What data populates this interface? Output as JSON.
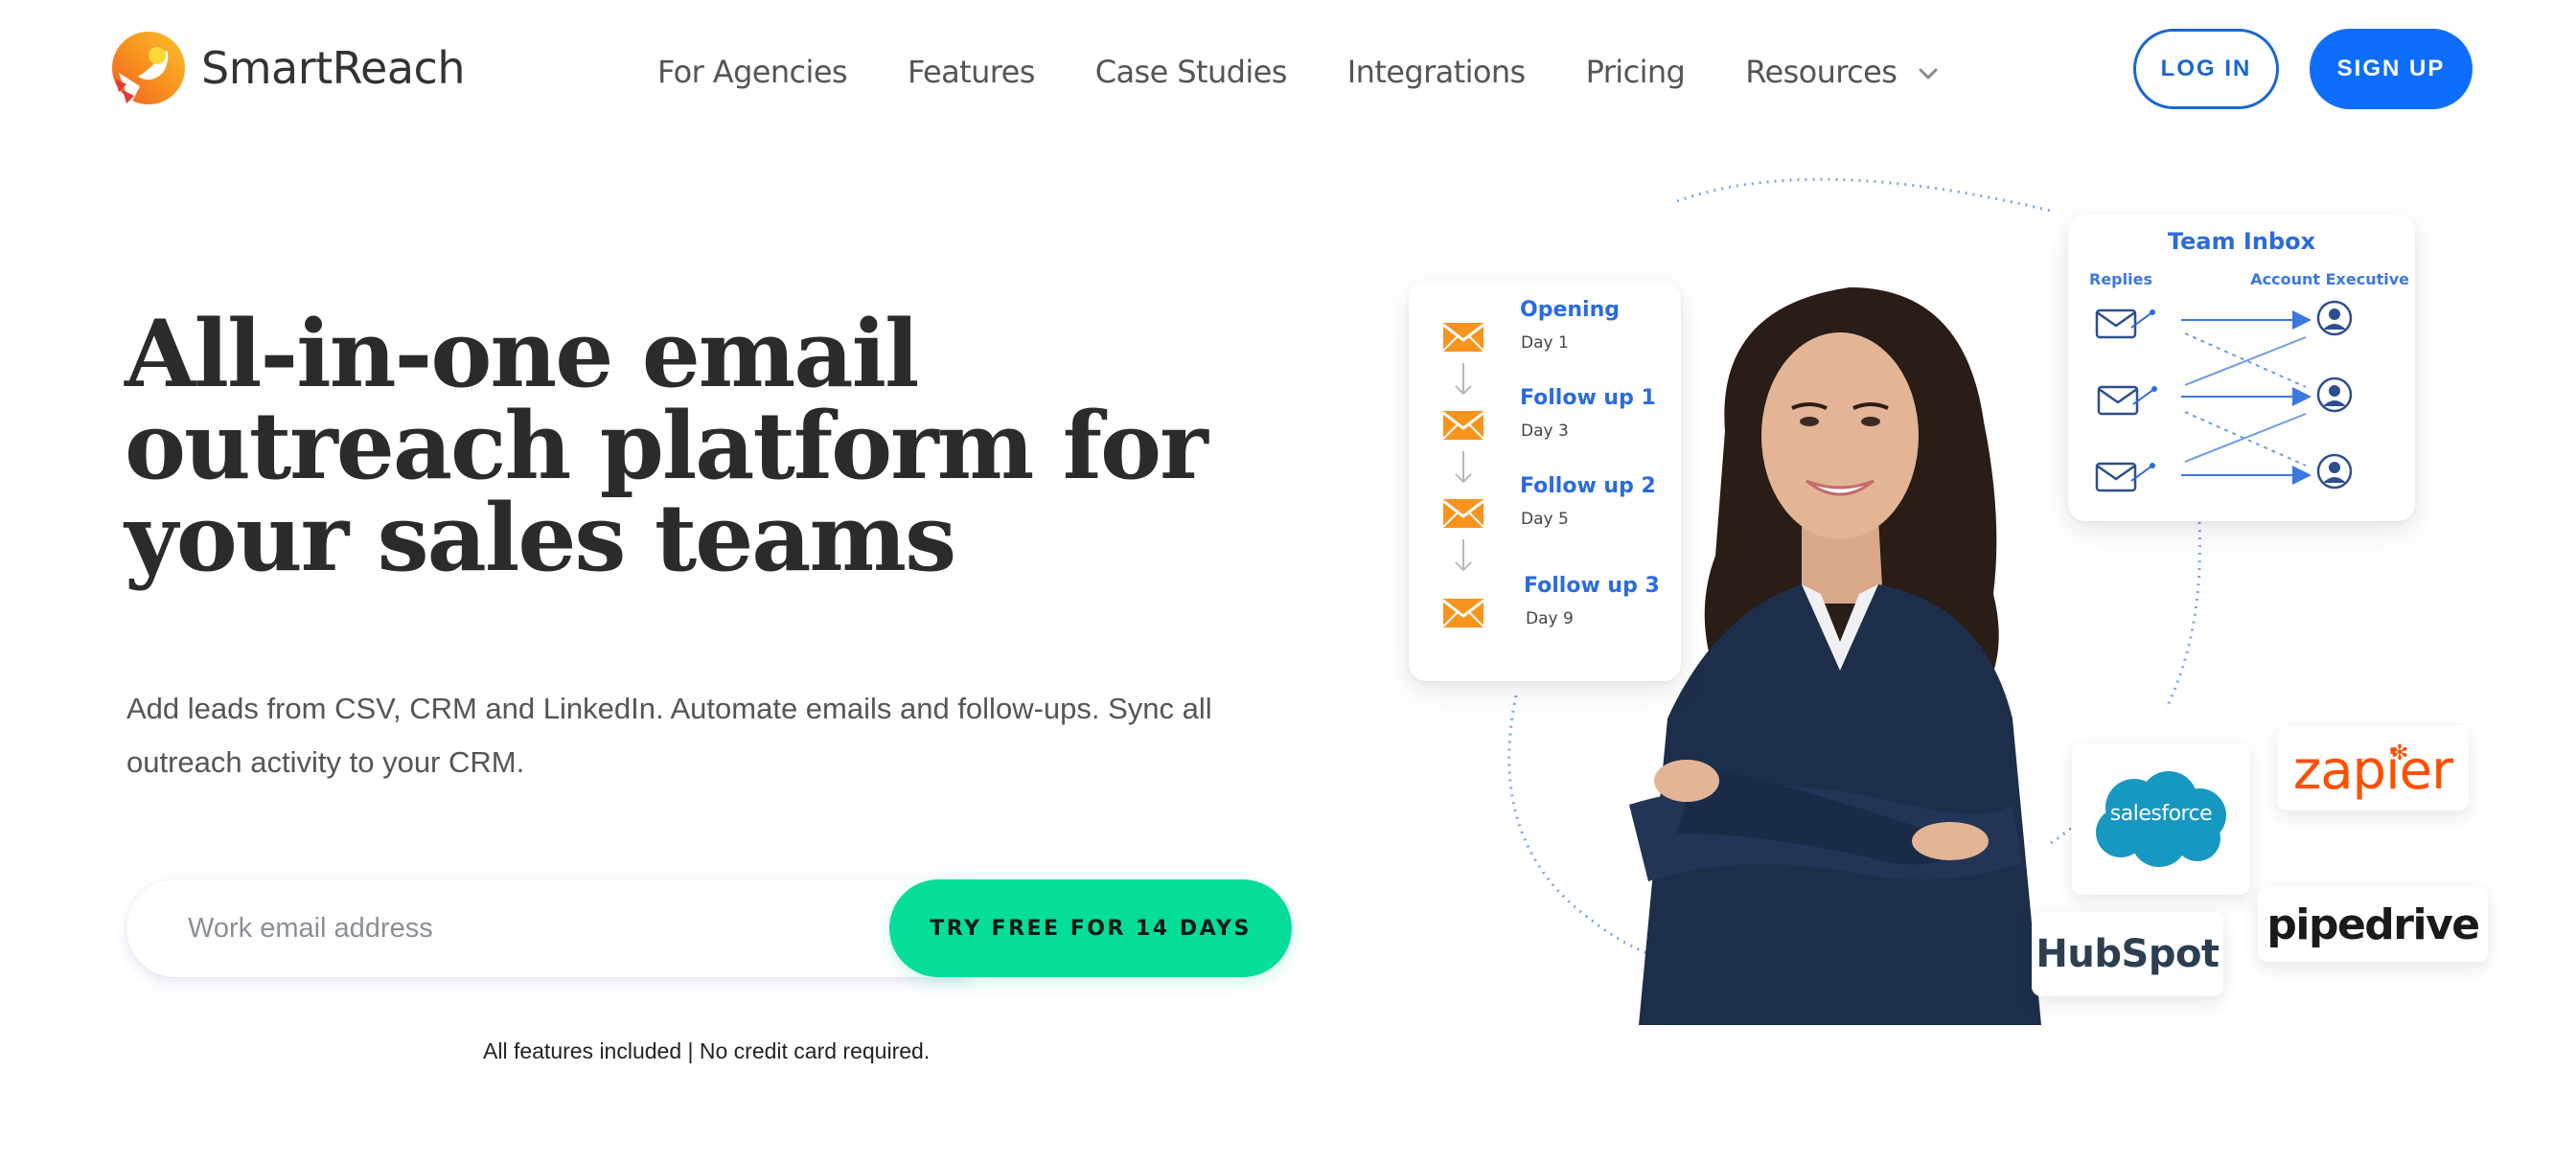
{
  "header": {
    "brand": "SmartReach",
    "nav": [
      {
        "label": "For Agencies"
      },
      {
        "label": "Features"
      },
      {
        "label": "Case Studies"
      },
      {
        "label": "Integrations"
      },
      {
        "label": "Pricing"
      },
      {
        "label": "Resources",
        "has_dropdown": true
      }
    ],
    "login_label": "LOG IN",
    "signup_label": "SIGN UP"
  },
  "hero": {
    "title": "All-in-one email outreach platform for your sales teams",
    "subtitle": "Add leads from CSV, CRM and LinkedIn. Automate emails and follow-ups. Sync all outreach activity to your CRM.",
    "email_placeholder": "Work email address",
    "email_value": "",
    "cta_label": "TRY FREE FOR 14 DAYS",
    "fineprint": "All features included | No credit card required."
  },
  "illustration": {
    "sequence": [
      {
        "title": "Opening",
        "day": "Day 1"
      },
      {
        "title": "Follow up 1",
        "day": "Day 3"
      },
      {
        "title": "Follow up 2",
        "day": "Day 5"
      },
      {
        "title": "Follow up 3",
        "day": "Day 9"
      }
    ],
    "team_inbox": {
      "title": "Team Inbox",
      "left_label": "Replies",
      "right_label": "Account Executive"
    },
    "integrations": [
      "salesforce",
      "zapier",
      "HubSpot",
      "pipedrive"
    ]
  },
  "colors": {
    "primary_blue": "#0d6efd",
    "login_border": "#1a66d1",
    "cta_green": "#05de9b",
    "heading": "#2b2b2b",
    "accent_orange": "#f7941d",
    "illustration_blue": "#2a6be0"
  }
}
